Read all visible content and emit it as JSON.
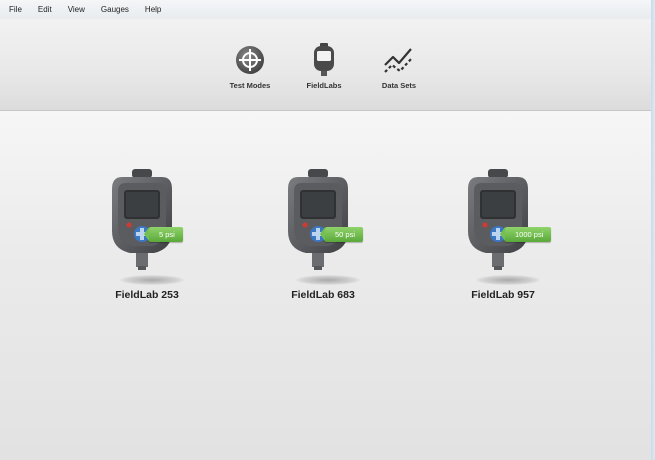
{
  "menubar": {
    "items": [
      "File",
      "Edit",
      "View",
      "Gauges",
      "Help"
    ]
  },
  "toolbar": {
    "buttons": [
      {
        "label": "Test Modes",
        "icon": "crosshair-icon"
      },
      {
        "label": "FieldLabs",
        "icon": "gauge-device-icon"
      },
      {
        "label": "Data Sets",
        "icon": "line-chart-icon"
      }
    ]
  },
  "devices": [
    {
      "name": "FieldLab 253",
      "range": "5 psi"
    },
    {
      "name": "FieldLab 683",
      "range": "50 psi"
    },
    {
      "name": "FieldLab 957",
      "range": "1000 psi"
    }
  ],
  "colors": {
    "badge_green": "#6ab848",
    "device_body": "#5d5f62",
    "background": "#e9e9e9",
    "dpad_blue": "#3b78c4"
  }
}
